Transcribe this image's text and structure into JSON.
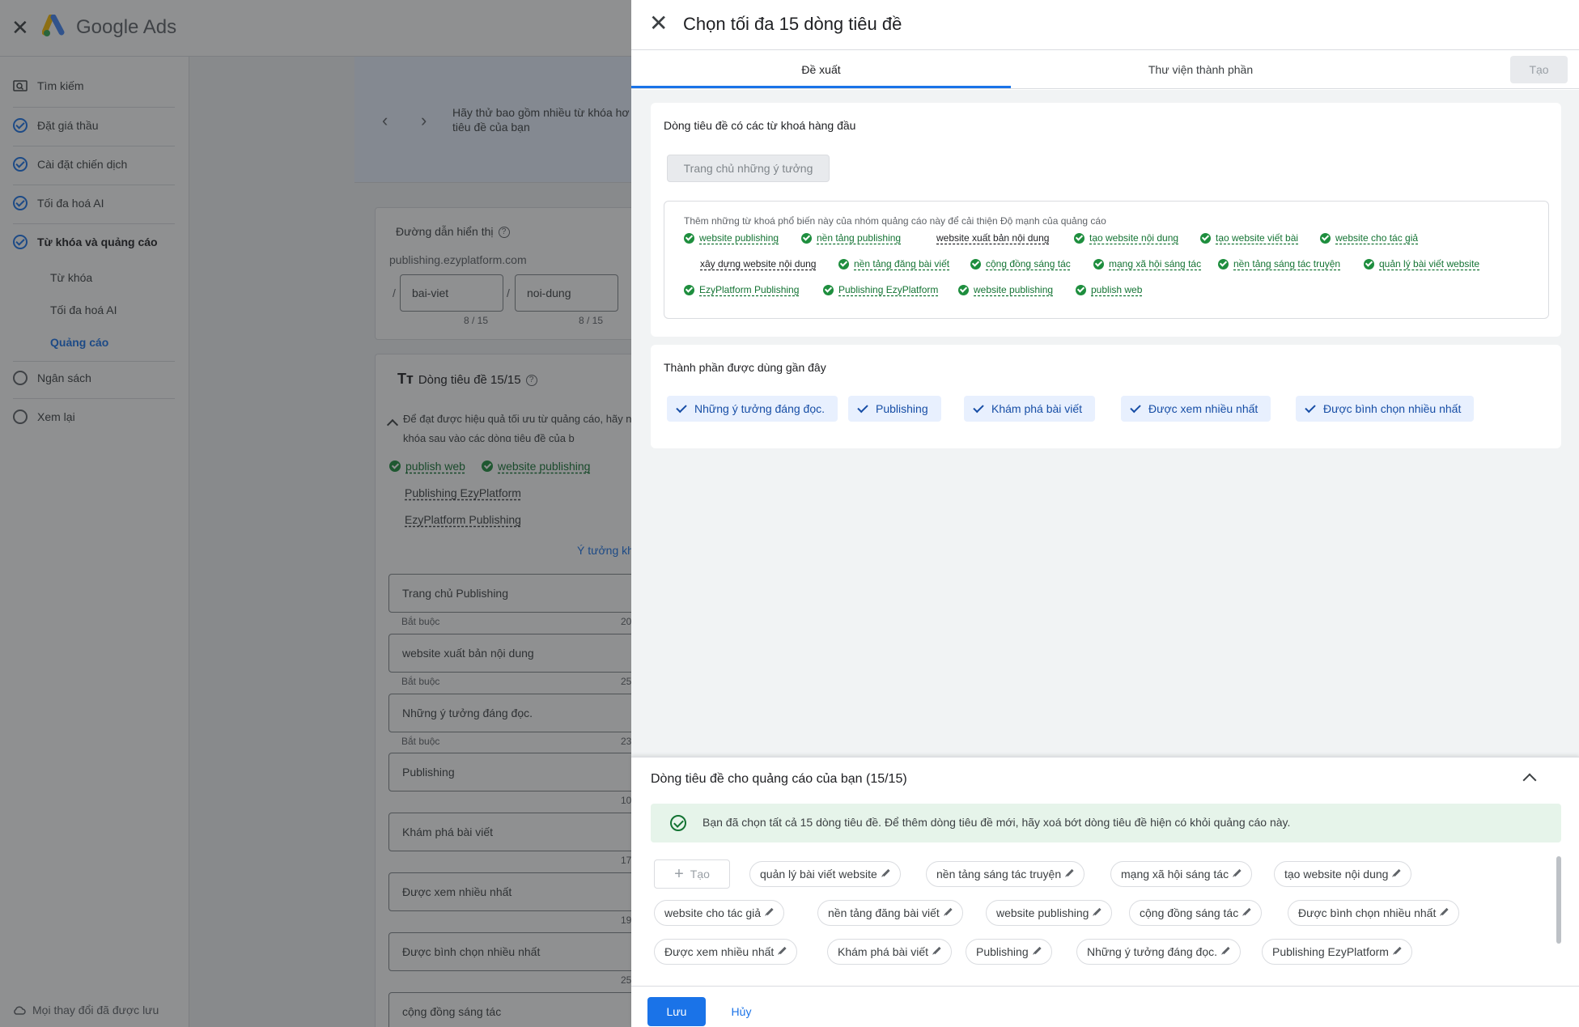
{
  "app": {
    "brand": "Google Ads",
    "saved_note": "Mọi thay đổi đã được lưu"
  },
  "sidebar": {
    "items": [
      {
        "label": "Tìm kiếm"
      },
      {
        "label": "Đặt giá thầu"
      },
      {
        "label": "Cài đặt chiến dịch"
      },
      {
        "label": "Tối đa hoá AI"
      },
      {
        "label": "Từ khóa và quảng cáo"
      }
    ],
    "sub_items": [
      {
        "label": "Từ khóa"
      },
      {
        "label": "Tối đa hoá AI"
      },
      {
        "label": "Quảng cáo"
      }
    ],
    "bottom_items": [
      {
        "label": "Ngân sách"
      },
      {
        "label": "Xem lại"
      }
    ]
  },
  "background": {
    "banner_text": "Hãy thử bao gồm nhiều từ khóa hơ dòng tiêu đề của bạn",
    "display_path": {
      "title": "Đường dẫn hiển thị",
      "domain": "publishing.ezyplatform.com",
      "path1": "bai-viet",
      "path2": "noi-dung",
      "count1": "8 / 15",
      "count2": "8 / 15"
    },
    "headlines": {
      "title": "Dòng tiêu đề 15/15",
      "hint": "Để đạt được hiệu quả tối ưu từ quảng cáo, hãy những từ khóa sau vào các dòng tiêu đề của b",
      "kw1": "publish web",
      "kw2": "website publishing",
      "kw3": "Publishing EzyPlatform",
      "kw4": "EzyPlatform Publishing",
      "ideas_link": "Ý tưởng kh",
      "required": "Bắt buộc",
      "inputs": [
        {
          "value": "Trang chủ Publishing",
          "count": "20"
        },
        {
          "value": "website xuất bản nội dung",
          "count": "25"
        },
        {
          "value": "Những ý tưởng đáng đọc.",
          "count": "23"
        },
        {
          "value": "Publishing",
          "count": "10"
        },
        {
          "value": "Khám phá bài viết",
          "count": "17"
        },
        {
          "value": "Được xem nhiều nhất",
          "count": "19"
        },
        {
          "value": "Được bình chọn nhiều nhất",
          "count": "25"
        },
        {
          "value": "cộng đồng sáng tác",
          "count": ""
        }
      ]
    }
  },
  "dialog": {
    "title": "Chọn tối đa 15 dòng tiêu đề",
    "tabs": [
      {
        "label": "Đề xuất"
      },
      {
        "label": "Thư viện thành phần"
      }
    ],
    "create_label": "Tạo",
    "suggestions": {
      "title": "Dòng tiêu đề có các từ khoá hàng đầu",
      "idea_chip": "Trang chủ những ý tưởng",
      "kw_box_title": "Thêm những từ khoá phổ biến này của nhóm quảng cáo này để cải thiện Độ mạnh của quảng cáo",
      "keywords": [
        "website publishing",
        "nền tảng publishing",
        "website xuất bản nội dung",
        "tạo website nội dung",
        "tạo website viết bài",
        "website cho tác giả",
        "xây dựng website nội dung",
        "nền tảng đăng bài viết",
        "cộng đồng sáng tác",
        "mạng xã hội sáng tác",
        "nền tảng sáng tác truyện",
        "quản lý bài viết website",
        "EzyPlatform Publishing",
        "Publishing EzyPlatform",
        "website publishing",
        "publish web"
      ]
    },
    "recent": {
      "title": "Thành phần được dùng gần đây",
      "chips": [
        "Những ý tưởng đáng đọc.",
        "Publishing",
        "Khám phá bài viết",
        "Được xem nhiều nhất",
        "Được bình chọn nhiều nhất"
      ]
    },
    "selected": {
      "title": "Dòng tiêu đề cho quảng cáo của bạn (15/15)",
      "success_msg": "Bạn đã chọn tất cả 15 dòng tiêu đề. Để thêm dòng tiêu đề mới, hãy xoá bớt dòng tiêu đề hiện có khỏi quảng cáo này.",
      "add_label": "Tạo",
      "chips": [
        "quản lý bài viết website",
        "nền tảng sáng tác truyện",
        "mạng xã hội sáng tác",
        "tạo website nội dung",
        "website cho tác giả",
        "nền tảng đăng bài viết",
        "website publishing",
        "cộng đồng sáng tác",
        "Được bình chọn nhiều nhất",
        "Được xem nhiều nhất",
        "Khám phá bài viết",
        "Publishing",
        "Những ý tưởng đáng đọc.",
        "Publishing EzyPlatform"
      ]
    },
    "save_label": "Lưu",
    "cancel_label": "Hủy"
  }
}
